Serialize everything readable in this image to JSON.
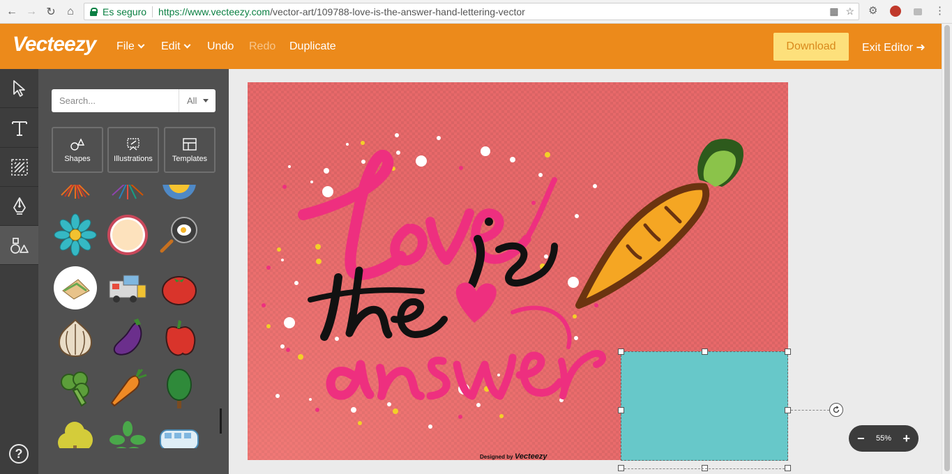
{
  "browser": {
    "secure_label": "Es seguro",
    "url_host": "https://www.vecteezy.com",
    "url_path": "/vector-art/109788-love-is-the-answer-hand-lettering-vector"
  },
  "header": {
    "logo": "Vecteezy",
    "menu": {
      "file": "File",
      "edit": "Edit",
      "undo": "Undo",
      "redo": "Redo",
      "duplicate": "Duplicate"
    },
    "download": "Download",
    "exit_editor": "Exit Editor"
  },
  "tools": [
    "select-tool",
    "text-tool",
    "pattern-tool",
    "pen-tool",
    "shapes-tool"
  ],
  "panel": {
    "search_placeholder": "Search...",
    "filter": "All",
    "categories": {
      "shapes": "Shapes",
      "illustrations": "Illustrations",
      "templates": "Templates"
    }
  },
  "artwork": {
    "line1": "Love",
    "line2": "is",
    "line3": "the",
    "line4": "answer",
    "signature_prefix": "Designed by",
    "signature_brand": "Vecteezy"
  },
  "zoom": {
    "minus": "−",
    "value": "55%",
    "plus": "+"
  },
  "colors": {
    "header": "#ec8a1b",
    "download_bg": "#fde07b",
    "canvas_bg": "#e8696a",
    "lettering_pink": "#ee2f7f",
    "selected_rect": "#67c8c9"
  }
}
